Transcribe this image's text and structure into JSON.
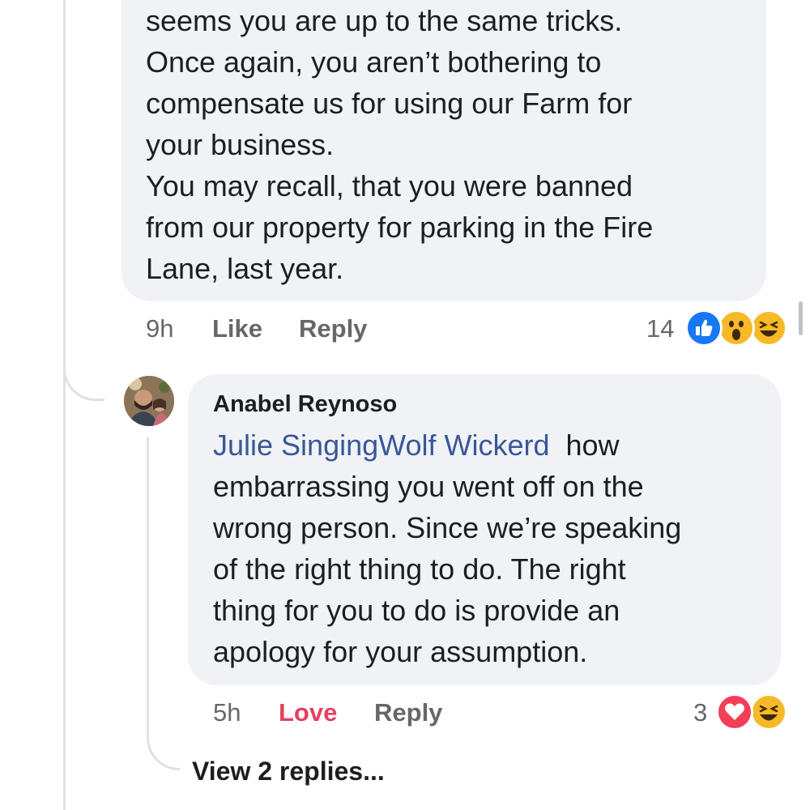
{
  "comment_1": {
    "lines": [
      "seems you are up to the same tricks.",
      "Once again, you aren’t bothering to",
      "compensate us for using our Farm for",
      "your business.",
      "You may recall, that you were banned",
      "from our property for parking in the Fire",
      "Lane, last year."
    ],
    "time": "9h",
    "like_label": "Like",
    "reply_label": "Reply",
    "reaction_count": "14",
    "reactions": [
      "like-reaction",
      "wow-reaction",
      "haha-reaction"
    ]
  },
  "comment_2": {
    "author": "Anabel Reynoso",
    "mention": "Julie SingingWolf Wickerd",
    "lines": [
      "how",
      "embarrassing you went off on the",
      "wrong person. Since we’re speaking",
      "of the right thing to do. The right",
      "thing for you to do is provide an",
      "apology for your assumption."
    ],
    "time": "5h",
    "love_label": "Love",
    "reply_label": "Reply",
    "reaction_count": "3",
    "reactions": [
      "love-reaction",
      "haha-reaction"
    ],
    "view_replies": "View 2 replies..."
  },
  "colors": {
    "bubble_bg": "#f0f2f5",
    "mention": "#385898",
    "love_active": "#e4405f",
    "like_blue": "#1877f2",
    "meta_gray": "#65676b"
  }
}
